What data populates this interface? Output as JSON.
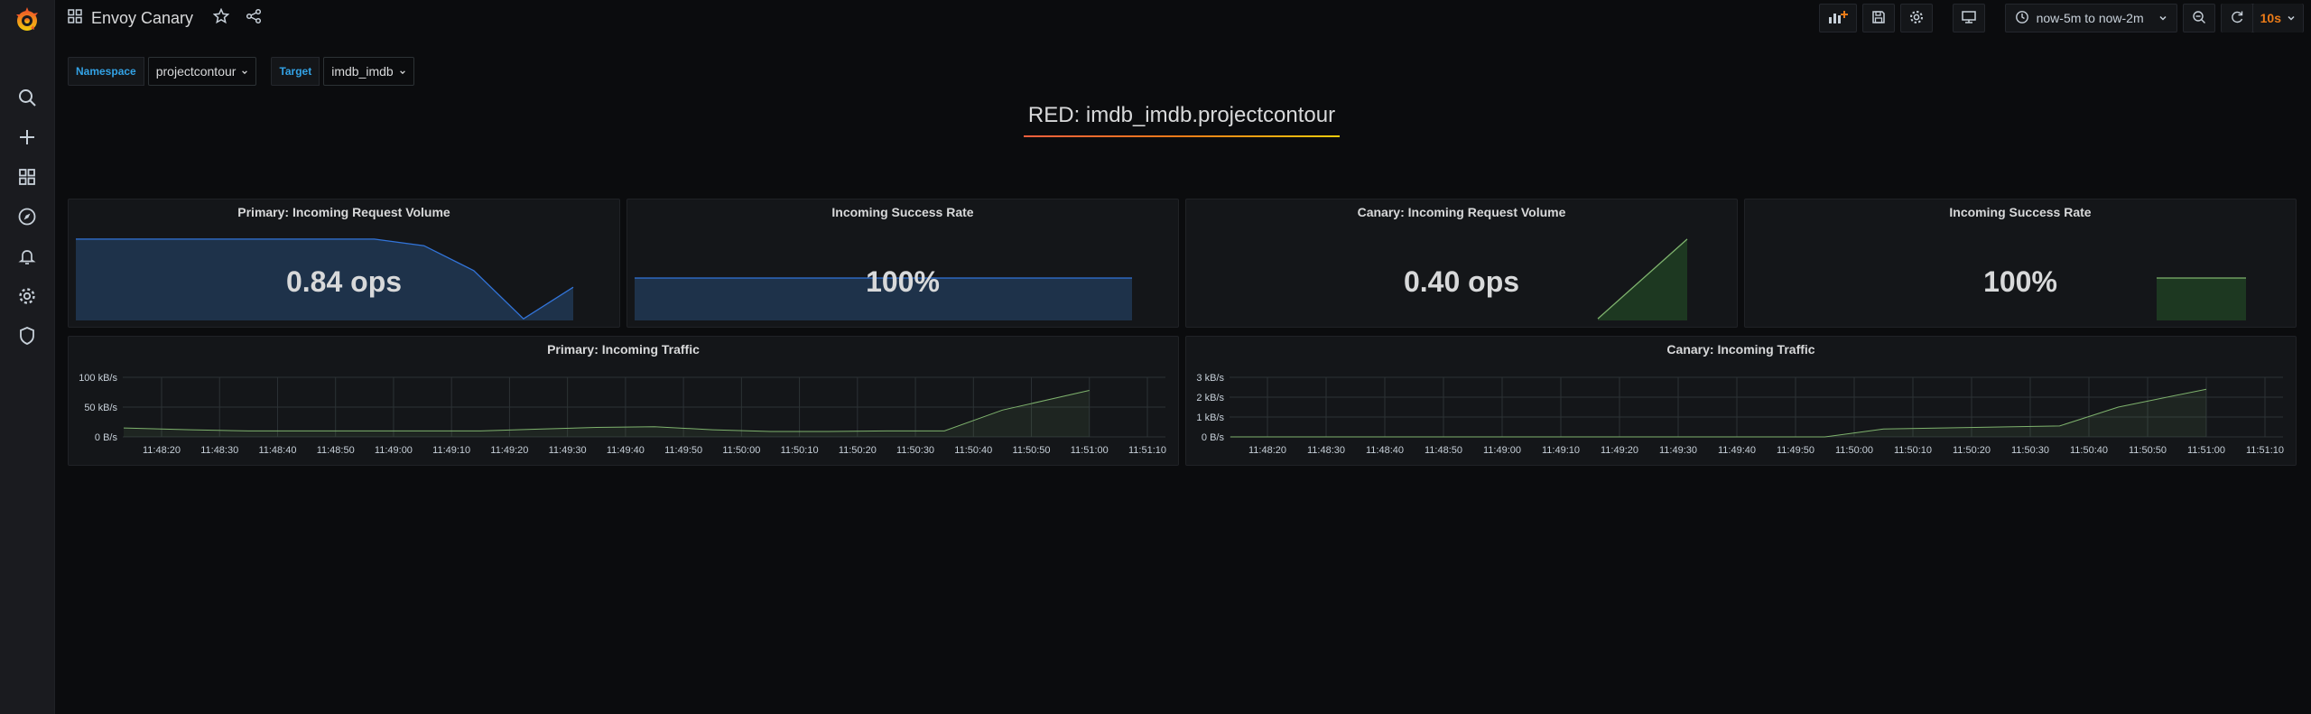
{
  "app": {
    "dashboard_title": "Envoy Canary"
  },
  "toolbar": {
    "time_range": "now-5m to now-2m",
    "refresh_interval": "10s"
  },
  "variables": [
    {
      "label": "Namespace",
      "value": "projectcontour"
    },
    {
      "label": "Target",
      "value": "imdb_imdb"
    }
  ],
  "header_text": "RED: imdb_imdb.projectcontour",
  "panels": {
    "primary_volume": {
      "title": "Primary: Incoming Request Volume",
      "value": "0.84 ops"
    },
    "primary_success": {
      "title": "Incoming Success Rate",
      "value": "100%"
    },
    "canary_volume": {
      "title": "Canary: Incoming Request Volume",
      "value": "0.40 ops"
    },
    "canary_success": {
      "title": "Incoming Success Rate",
      "value": "100%"
    },
    "primary_traffic": {
      "title": "Primary: Incoming Traffic"
    },
    "canary_traffic": {
      "title": "Canary: Incoming Traffic"
    }
  },
  "colors": {
    "blue_series": "#3274d9",
    "green_series": "#7eb26d",
    "brand_orange": "#eb7b18",
    "variable_label": "#33a2e5"
  },
  "chart_data": [
    {
      "type": "area",
      "panel": "primary_volume",
      "series": [
        {
          "values": [
            0.98,
            0.98,
            0.98,
            0.98,
            0.98,
            0.98,
            0.98,
            0.9,
            0.6,
            0.02,
            0.4
          ]
        }
      ]
    },
    {
      "type": "area",
      "panel": "primary_success",
      "series": [
        {
          "values": [
            1,
            1,
            1,
            1,
            1,
            1,
            1,
            1,
            1,
            1,
            1
          ]
        }
      ]
    },
    {
      "type": "area",
      "panel": "canary_volume",
      "series": [
        {
          "values": [
            0.02,
            0.5,
            0.98
          ]
        }
      ]
    },
    {
      "type": "area",
      "panel": "canary_success",
      "series": [
        {
          "values": [
            1,
            1
          ]
        }
      ]
    },
    {
      "type": "area",
      "panel": "primary_traffic",
      "x": [
        "11:48:20",
        "11:48:30",
        "11:48:40",
        "11:48:50",
        "11:49:00",
        "11:49:10",
        "11:49:20",
        "11:49:30",
        "11:49:40",
        "11:49:50",
        "11:50:00",
        "11:50:10",
        "11:50:20",
        "11:50:30",
        "11:50:40",
        "11:50:50",
        "11:51:00",
        "11:51:10"
      ],
      "ylim": [
        0,
        100
      ],
      "y_ticks": [
        "100 kB/s",
        "50 kB/s",
        "0 B/s"
      ],
      "series": [
        {
          "values": [
            15,
            12,
            10,
            10,
            10,
            10,
            10,
            13,
            16,
            17,
            12,
            9,
            9,
            10,
            10,
            45,
            78,
            null
          ]
        }
      ]
    },
    {
      "type": "area",
      "panel": "canary_traffic",
      "x": [
        "11:48:20",
        "11:48:30",
        "11:48:40",
        "11:48:50",
        "11:49:00",
        "11:49:10",
        "11:49:20",
        "11:49:30",
        "11:49:40",
        "11:49:50",
        "11:50:00",
        "11:50:10",
        "11:50:20",
        "11:50:30",
        "11:50:40",
        "11:50:50",
        "11:51:00",
        "11:51:10"
      ],
      "ylim": [
        0,
        3
      ],
      "y_ticks": [
        "3 kB/s",
        "2 kB/s",
        "1 kB/s",
        "0 B/s"
      ],
      "series": [
        {
          "values": [
            0,
            0,
            0,
            0,
            0,
            0,
            0,
            0,
            0,
            0,
            0,
            0.4,
            0.45,
            0.5,
            0.55,
            1.5,
            2.4,
            null
          ]
        }
      ]
    }
  ]
}
